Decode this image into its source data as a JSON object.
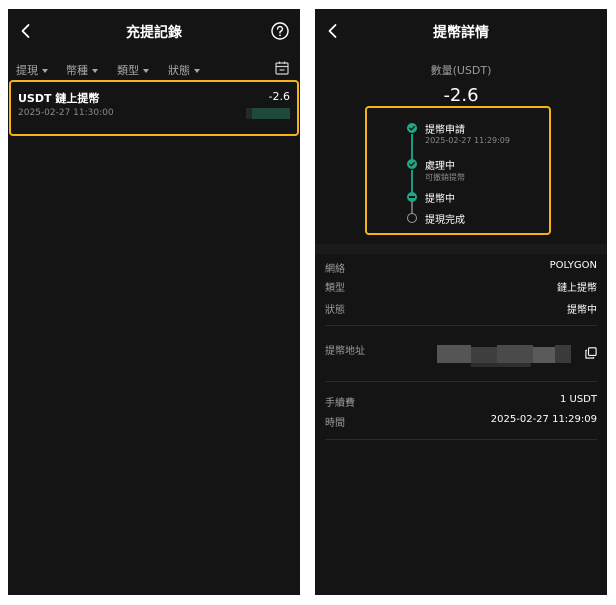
{
  "records_screen": {
    "title": "充提記錄",
    "filters": [
      "提現",
      "幣種",
      "類型",
      "狀態"
    ],
    "record": {
      "name": "USDT 鏈上提幣",
      "time": "2025-02-27 11:30:00",
      "amount": "-2.6"
    },
    "icons": [
      "back-icon",
      "help-icon",
      "calendar-icon"
    ],
    "highlight_color": "#f1b419"
  },
  "detail_screen": {
    "title": "提幣詳情",
    "amount_label": "數量(USDT)",
    "amount": "-2.6",
    "steps": [
      {
        "title": "提幣申請",
        "sub": "2025-02-27 11:29:09",
        "state": "done"
      },
      {
        "title": "處理中",
        "sub": "可撤銷提幣",
        "state": "done"
      },
      {
        "title": "提幣中",
        "sub": "",
        "state": "current"
      },
      {
        "title": "提現完成",
        "sub": "",
        "state": "pending"
      }
    ],
    "rows": [
      {
        "label": "網絡",
        "value": "POLYGON"
      },
      {
        "label": "類型",
        "value": "鏈上提幣"
      },
      {
        "label": "狀態",
        "value": "提幣中"
      }
    ],
    "address_label": "提幣地址",
    "fee_label": "手續費",
    "fee_value": "1 USDT",
    "time_label": "時間",
    "time_value": "2025-02-27 11:29:09",
    "accent_color": "#1fa885",
    "icons": [
      "back-icon",
      "copy-icon",
      "check-icon"
    ]
  }
}
